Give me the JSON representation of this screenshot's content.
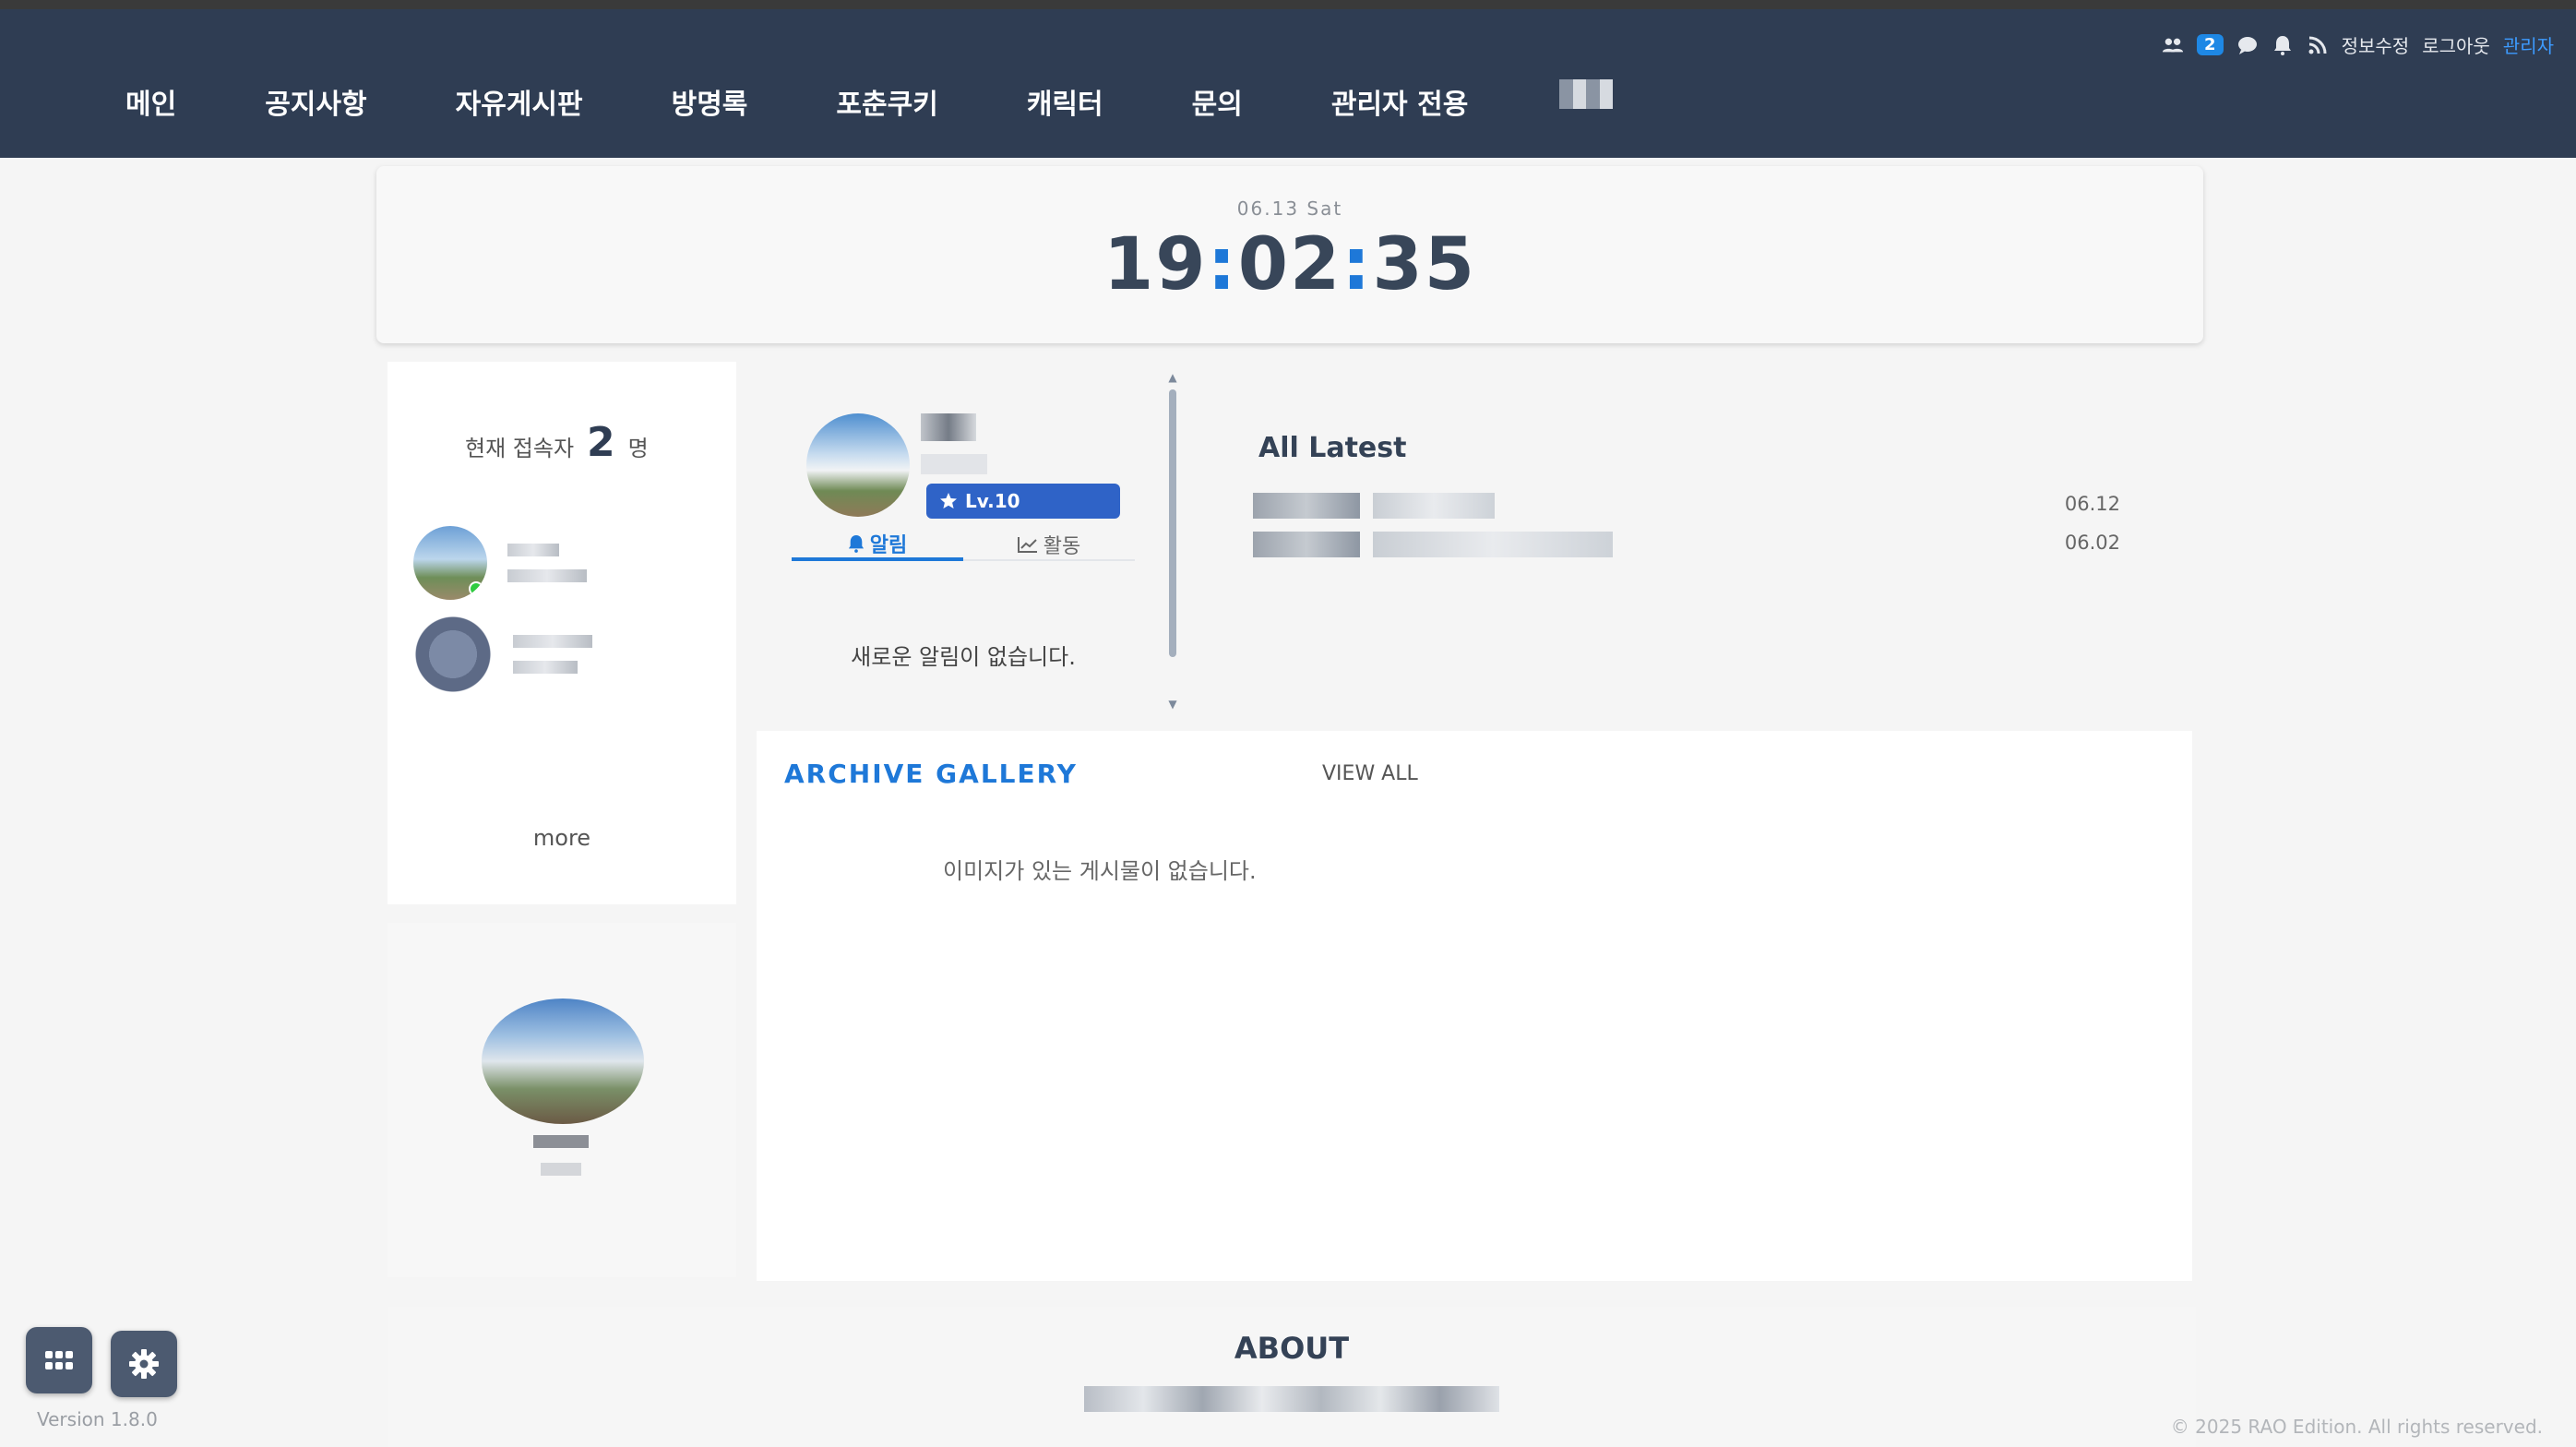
{
  "nav": {
    "items": [
      "메인",
      "공지사항",
      "자유게시판",
      "방명록",
      "포춘쿠키",
      "캐릭터",
      "문의",
      "관리자 전용"
    ]
  },
  "util": {
    "user_count": "2",
    "edit_profile": "정보수정",
    "logout": "로그아웃",
    "admin": "관리자"
  },
  "clock": {
    "date": "06.13 Sat",
    "hours": "19",
    "minutes": "02",
    "seconds": "35"
  },
  "visitors": {
    "label": "현재 접속자",
    "count": "2",
    "unit": "명",
    "more": "more"
  },
  "user": {
    "level": "Lv.10",
    "tabs": [
      "알림",
      "활동"
    ],
    "empty_notice": "새로운 알림이 없습니다."
  },
  "latest": {
    "title": "All Latest",
    "dates": [
      "06.12",
      "06.02"
    ]
  },
  "gallery": {
    "title": "ARCHIVE GALLERY",
    "view_all": "VIEW ALL",
    "empty": "이미지가 있는 게시물이 없습니다."
  },
  "about": {
    "title": "ABOUT"
  },
  "footer": {
    "version": "Version 1.8.0",
    "copyright": "© 2025 RAO Edition. All rights reserved."
  },
  "colors": {
    "header": "#2f3d53",
    "accent": "#1e78d8",
    "level_badge": "#2f63c7"
  },
  "icons": [
    "users-icon",
    "chat-icon",
    "bell-icon",
    "rss-icon",
    "star-icon",
    "chart-icon",
    "grid-icon",
    "gear-icon"
  ]
}
